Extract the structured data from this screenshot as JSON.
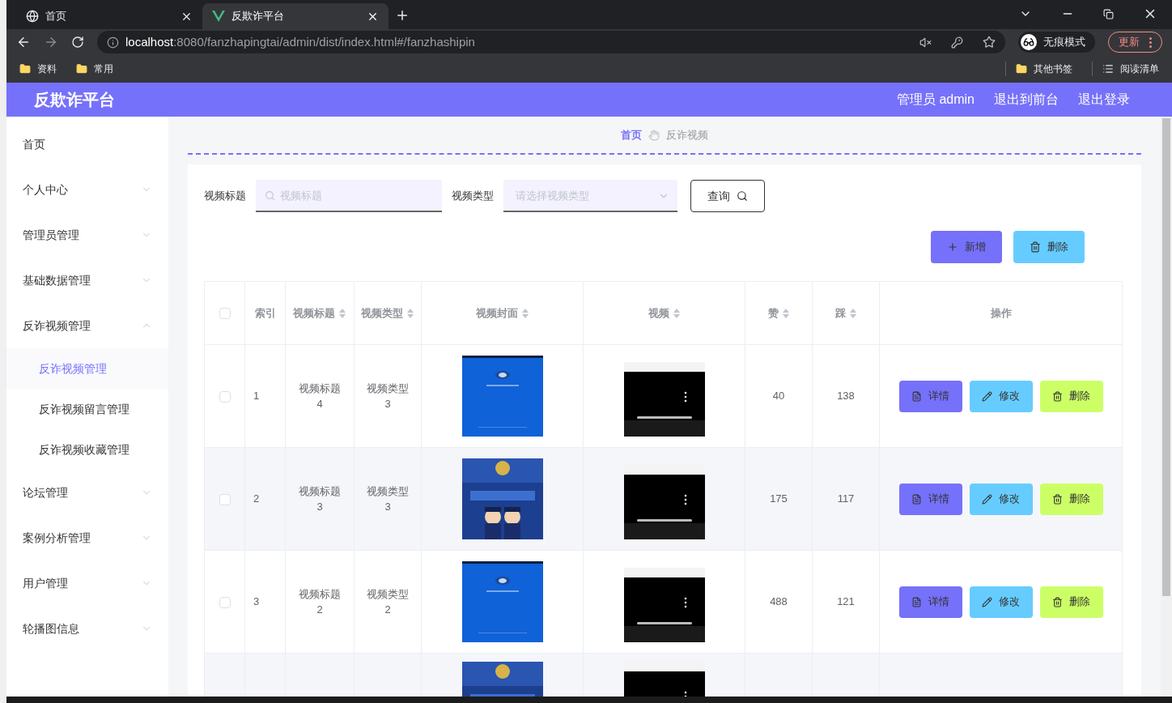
{
  "browser": {
    "tabs": [
      {
        "title": "首页",
        "selected": false
      },
      {
        "title": "反欺诈平台",
        "selected": true
      }
    ],
    "url_host": "localhost",
    "url_path": ":8080/fanzhapingtai/admin/dist/index.html#/fanzhashipin",
    "profile": "无痕模式",
    "update_button": "更新",
    "bookmarks": [
      "资料",
      "常用"
    ],
    "bookmarks_right": [
      {
        "label": "其他书签",
        "kind": "folder"
      },
      {
        "label": "阅读清单",
        "kind": "list"
      }
    ]
  },
  "app": {
    "title": "反欺诈平台",
    "header_links": [
      "管理员 admin",
      "退出到前台",
      "退出登录"
    ]
  },
  "sidebar": {
    "items": [
      {
        "label": "首页",
        "kind": "link"
      },
      {
        "label": "个人中心",
        "kind": "menu",
        "expanded": false
      },
      {
        "label": "管理员管理",
        "kind": "menu",
        "expanded": false
      },
      {
        "label": "基础数据管理",
        "kind": "menu",
        "expanded": false
      },
      {
        "label": "反诈视频管理",
        "kind": "menu",
        "expanded": true,
        "children": [
          {
            "label": "反诈视频管理",
            "selected": true
          },
          {
            "label": "反诈视频留言管理",
            "selected": false
          },
          {
            "label": "反诈视频收藏管理",
            "selected": false
          }
        ]
      },
      {
        "label": "论坛管理",
        "kind": "menu",
        "expanded": false
      },
      {
        "label": "案例分析管理",
        "kind": "menu",
        "expanded": false
      },
      {
        "label": "用户管理",
        "kind": "menu",
        "expanded": false
      },
      {
        "label": "轮播图信息",
        "kind": "menu",
        "expanded": false
      }
    ]
  },
  "breadcrumb": [
    "首页",
    "反诈视频"
  ],
  "filters": [
    {
      "label": "视频标题",
      "kind": "search",
      "placeholder": "视频标题"
    },
    {
      "label": "视频类型",
      "kind": "select",
      "placeholder": "请选择视频类型"
    }
  ],
  "query_button": "查询",
  "toolbar": [
    {
      "label": "新增",
      "kind": "add"
    },
    {
      "label": "删除",
      "kind": "delete"
    }
  ],
  "table": {
    "select_all_checked": false,
    "columns": [
      {
        "label": "索引",
        "sortable": false
      },
      {
        "label": "视频标题",
        "sortable": true
      },
      {
        "label": "视频类型",
        "sortable": true
      },
      {
        "label": "视频封面",
        "sortable": true
      },
      {
        "label": "视频",
        "sortable": true
      },
      {
        "label": "赞",
        "sortable": true
      },
      {
        "label": "踩",
        "sortable": true
      },
      {
        "label": "操作",
        "sortable": false
      }
    ],
    "rows": [
      {
        "checked": false,
        "index": "1",
        "title": "视频标题4",
        "type": "视频类型3",
        "likes": "40",
        "dislikes": "138",
        "actions": [
          {
            "label": "详情",
            "kind": "detail"
          },
          {
            "label": "修改",
            "kind": "edit"
          },
          {
            "label": "删除",
            "kind": "delete"
          }
        ]
      },
      {
        "checked": false,
        "index": "2",
        "title": "视频标题3",
        "type": "视频类型3",
        "likes": "175",
        "dislikes": "117",
        "actions": [
          {
            "label": "详情",
            "kind": "detail"
          },
          {
            "label": "修改",
            "kind": "edit"
          },
          {
            "label": "删除",
            "kind": "delete"
          }
        ]
      },
      {
        "checked": false,
        "index": "3",
        "title": "视频标题2",
        "type": "视频类型2",
        "likes": "488",
        "dislikes": "121",
        "actions": [
          {
            "label": "详情",
            "kind": "detail"
          },
          {
            "label": "修改",
            "kind": "edit"
          },
          {
            "label": "删除",
            "kind": "delete"
          }
        ]
      }
    ]
  }
}
